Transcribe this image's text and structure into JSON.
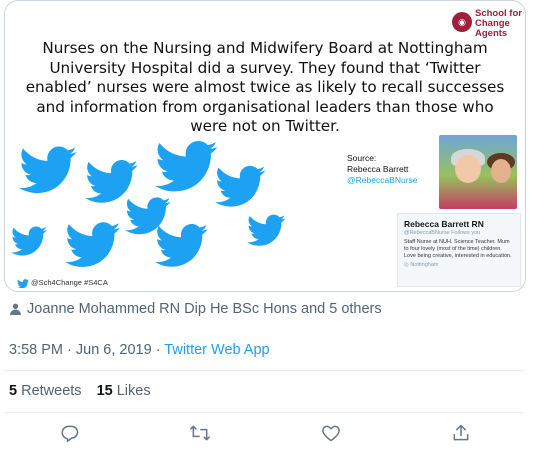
{
  "slide": {
    "text": "Nurses on the Nursing and Midwifery Board at Nottingham\nUniversity Hospital did a survey. They found that ‘Twitter\nenabled’ nurses were almost twice as likely to recall successes\nand information from organisational leaders than those who\nwere not on Twitter.",
    "logo_text": "School for\nChange\nAgents",
    "source_label": "Source:",
    "source_name": "Rebecca Barrett",
    "source_handle": "@RebeccaBNurse",
    "footer_tag": "@Sch4Change #S4CA"
  },
  "profile_card": {
    "name": "Rebecca Barrett RN",
    "handle": "@RebeccaBNurse  Follows you",
    "bio": "Staff Nurse at NUH. Science Teacher. Mum to four lovely (most of the time) children. Love being creative, interested in education.",
    "location": "Nottingham"
  },
  "liked_by": "Joanne Mohammed RN Dip He BSc Hons and 5 others",
  "timestamp": {
    "time": "3:58 PM · Jun 6, 2019 · ",
    "app": "Twitter Web App"
  },
  "stats": {
    "retweets_count": "5",
    "retweets_label": "Retweets",
    "likes_count": "15",
    "likes_label": "Likes"
  },
  "actions": [
    "reply-icon",
    "retweet-icon",
    "like-icon",
    "share-icon"
  ],
  "colors": {
    "twitter_blue": "#1da1f2",
    "logo_red": "#a0203b",
    "muted": "#536471"
  }
}
